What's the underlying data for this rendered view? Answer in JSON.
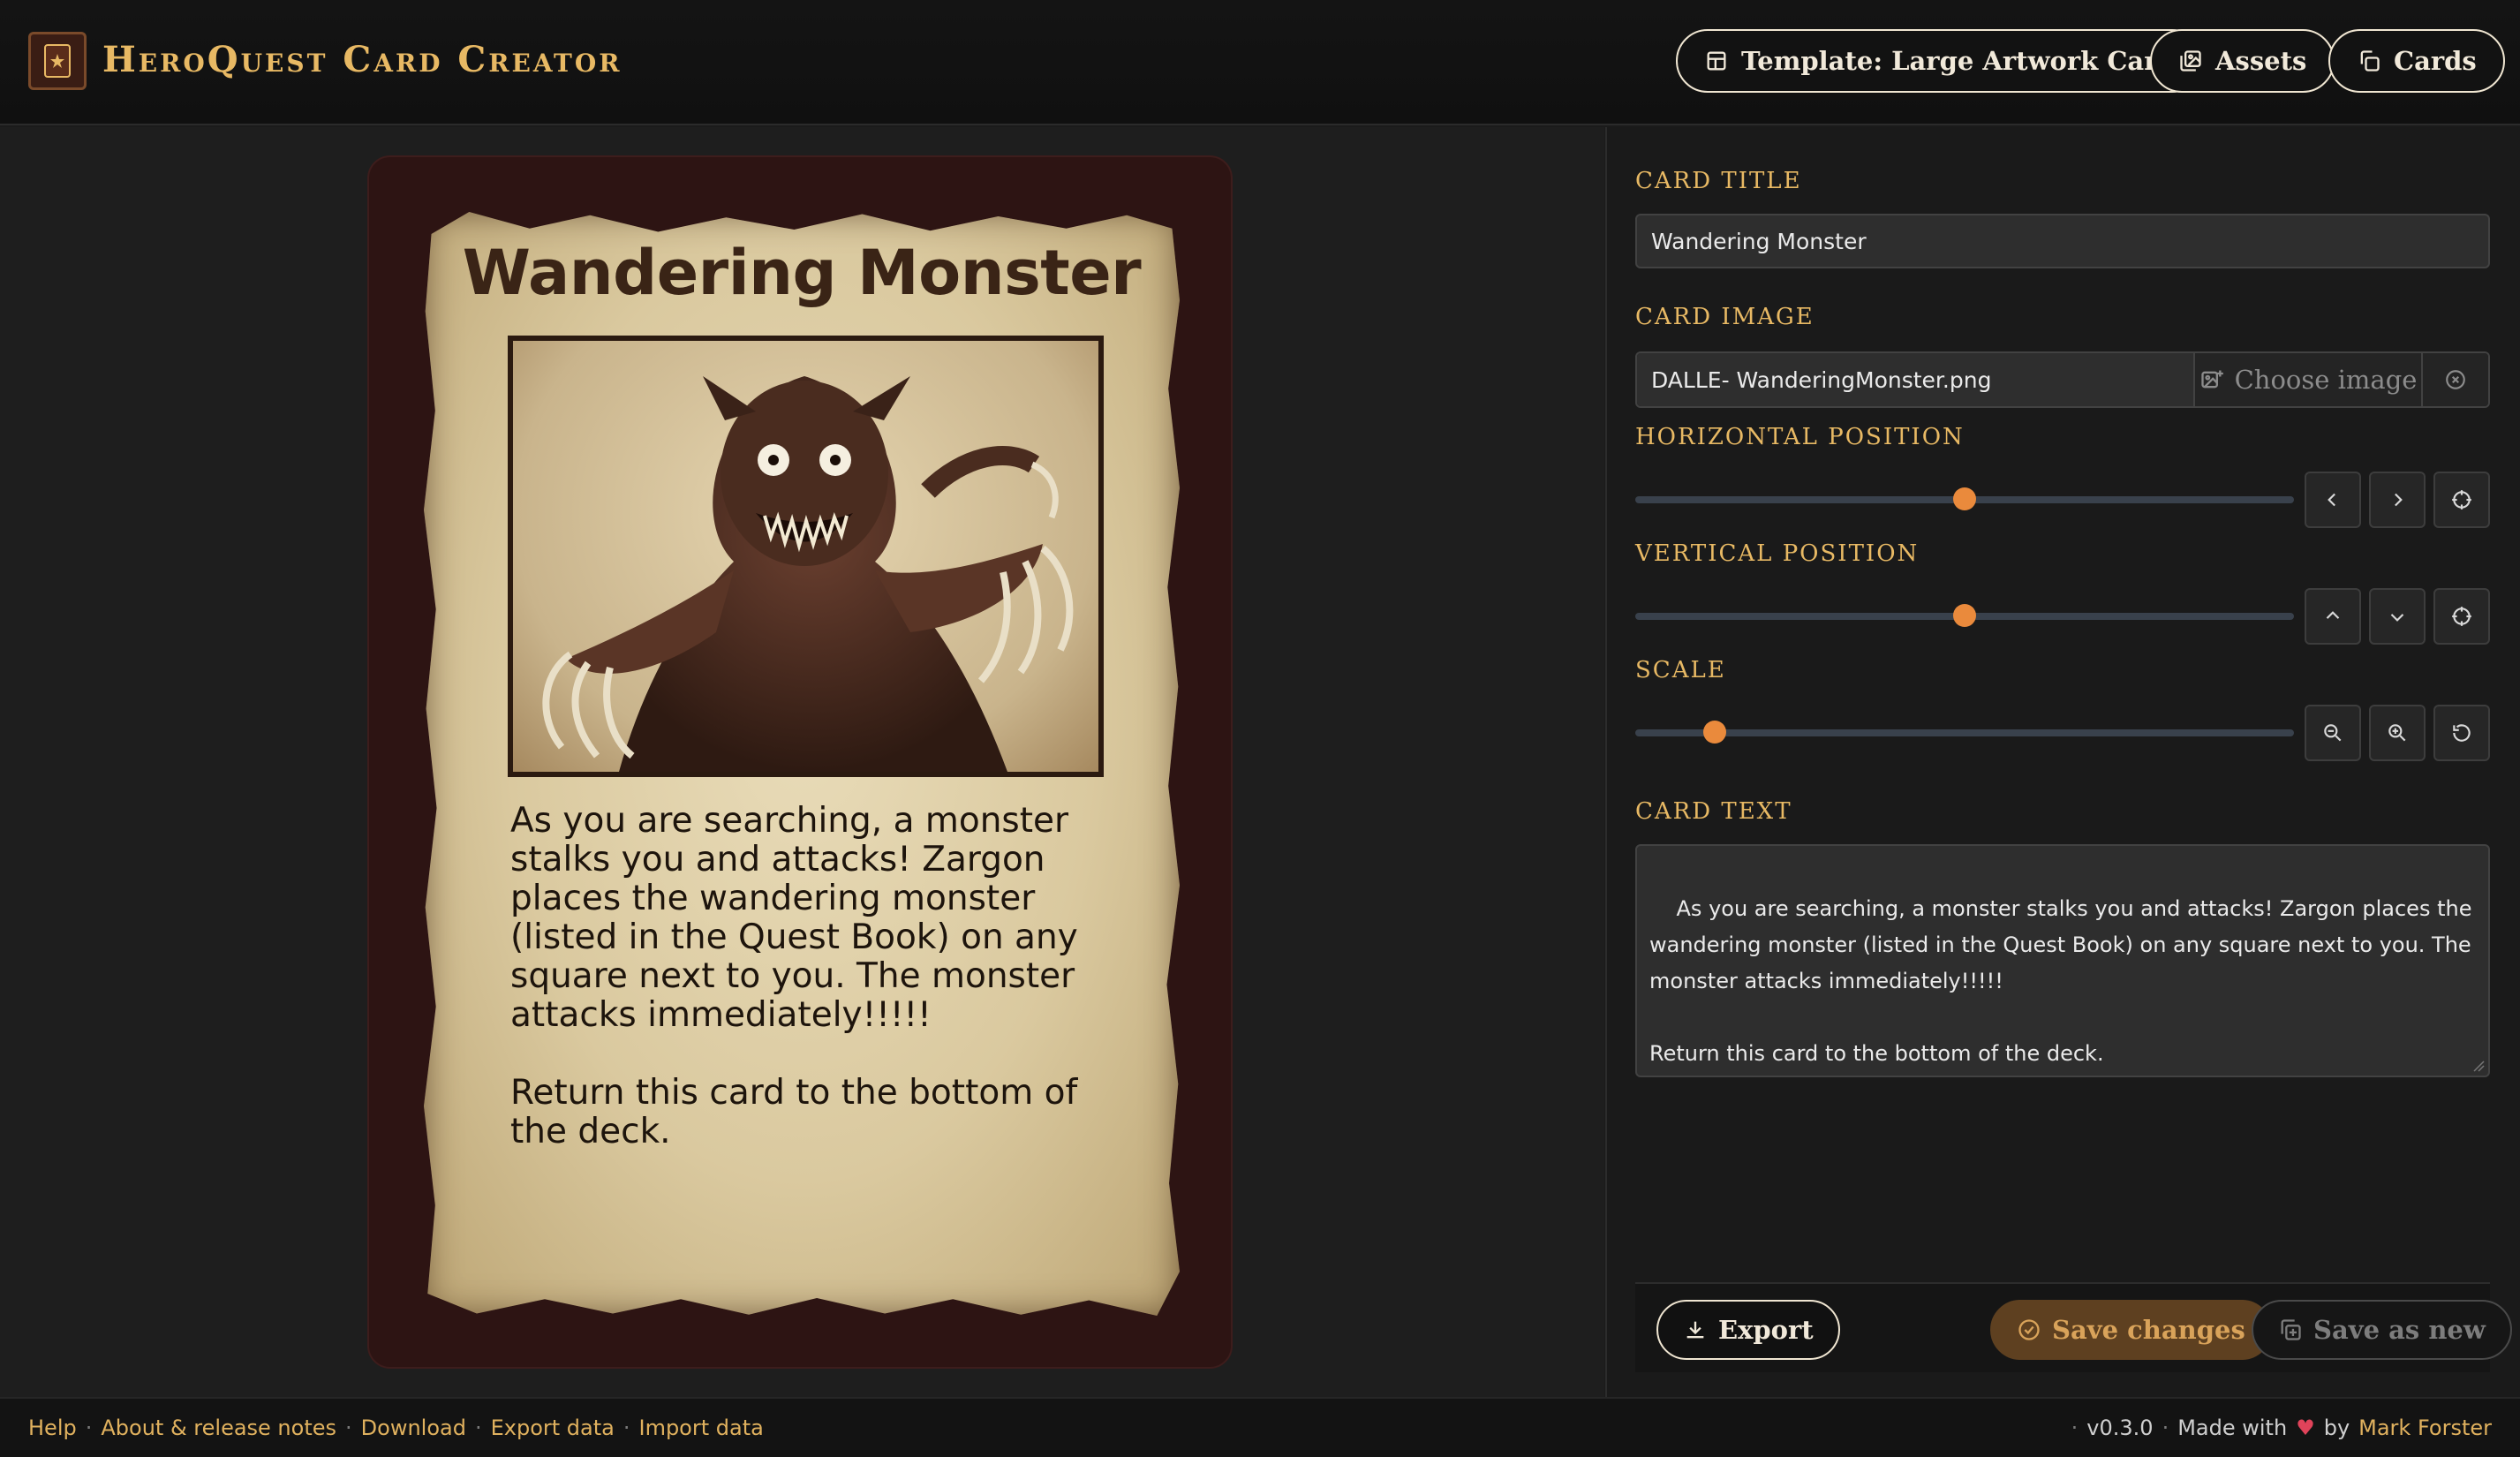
{
  "header": {
    "app_title": "HeroQuest Card Creator",
    "template_button": "Template: Large Artwork Card",
    "assets_button": "Assets",
    "cards_button": "Cards"
  },
  "card": {
    "title": "Wandering Monster",
    "text": "As you are searching, a monster stalks you and attacks! Zargon places the wandering monster (listed in the Quest Book) on any square next to you. The monster attacks immediately!!!!!\n\nReturn this card to the bottom of the deck."
  },
  "editor": {
    "title_label": "CARD TITLE",
    "title_value": "Wandering Monster",
    "image_label": "CARD IMAGE",
    "image_filename": "DALLE- WanderingMonster.png",
    "choose_image_label": "Choose image",
    "horizontal_label": "HORIZONTAL POSITION",
    "horizontal_value": 0.5,
    "vertical_label": "VERTICAL POSITION",
    "vertical_value": 0.5,
    "scale_label": "SCALE",
    "scale_value": 0.12,
    "text_label": "CARD TEXT",
    "text_value": "As you are searching, a monster stalks you and attacks! Zargon places the wandering monster (listed in the Quest Book) on any square next to you. The monster attacks immediately!!!!!\n\nReturn this card to the bottom of the deck."
  },
  "actions": {
    "export": "Export",
    "save_changes": "Save changes",
    "save_as_new": "Save as new"
  },
  "footer": {
    "links": [
      "Help",
      "About & release notes",
      "Download",
      "Export data",
      "Import data"
    ],
    "version": "v0.3.0",
    "made_with": "Made with",
    "by": "by",
    "author": "Mark Forster"
  },
  "colors": {
    "accent": "#e8b964",
    "slider_knob": "#ea8a3c",
    "card_border": "#2d1413",
    "save_button_bg": "#5e4020"
  },
  "icons": {
    "template": "layout-icon",
    "assets": "images-icon",
    "cards": "copy-icon",
    "choose_image": "image-add-icon",
    "clear": "circle-x-icon",
    "export": "download-icon",
    "save": "circle-check-icon",
    "save_as_new": "copy-plus-icon"
  }
}
